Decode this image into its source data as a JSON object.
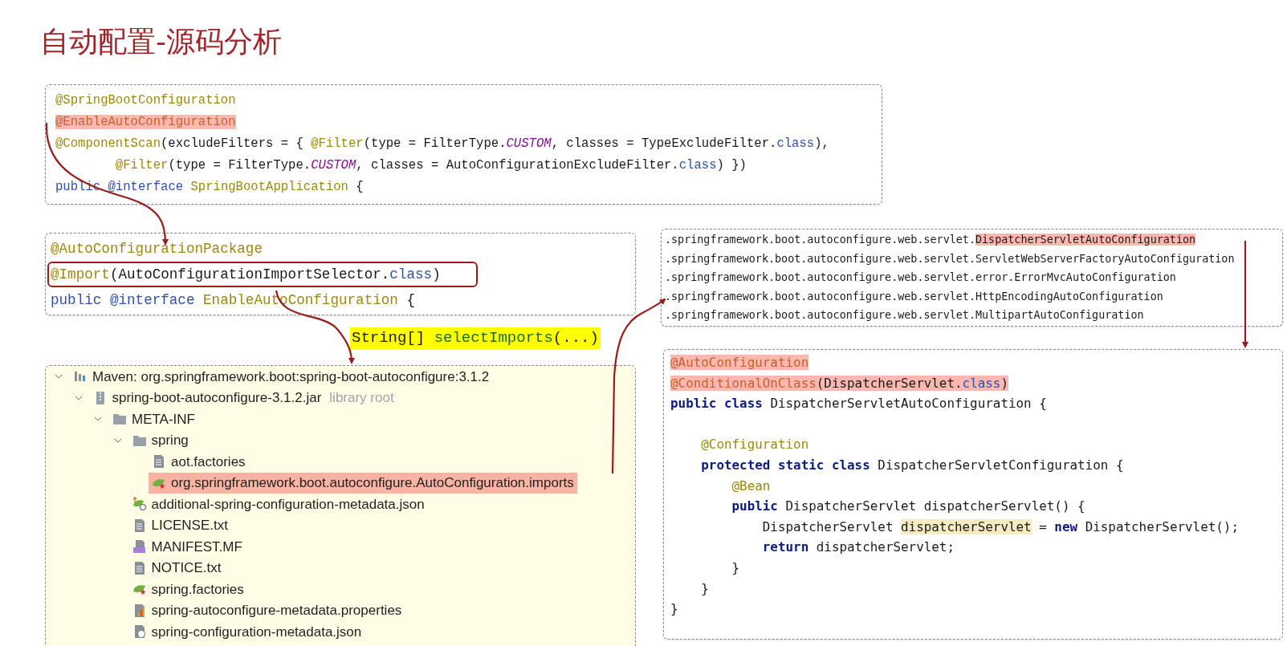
{
  "title": "自动配置-源码分析",
  "top_code": {
    "lines": [
      {
        "tokens": [
          {
            "text": "@SpringBootConfiguration",
            "kind": "annotation"
          }
        ]
      },
      {
        "tokens": [
          {
            "text": "@EnableAutoConfiguration",
            "kind": "annotation-hl"
          }
        ]
      },
      {
        "tokens": [
          {
            "text": "@ComponentScan",
            "kind": "annotation"
          },
          {
            "text": "(excludeFilters = { ",
            "kind": "text"
          },
          {
            "text": "@Filter",
            "kind": "annotation"
          },
          {
            "text": "(type = FilterType.",
            "kind": "text"
          },
          {
            "text": "CUSTOM",
            "kind": "const"
          },
          {
            "text": ", classes = TypeExcludeFilter.",
            "kind": "text"
          },
          {
            "text": "class",
            "kind": "keyword"
          },
          {
            "text": "),",
            "kind": "text"
          }
        ]
      },
      {
        "tokens": [
          {
            "text": "        @Filter",
            "kind": "annotation"
          },
          {
            "text": "(type = FilterType.",
            "kind": "text"
          },
          {
            "text": "CUSTOM",
            "kind": "const"
          },
          {
            "text": ", classes = AutoConfigurationExcludeFilter.",
            "kind": "text"
          },
          {
            "text": "class",
            "kind": "keyword"
          },
          {
            "text": ") })",
            "kind": "text"
          }
        ]
      },
      {
        "tokens": [
          {
            "text": "public ",
            "kind": "keyword"
          },
          {
            "text": "@interface ",
            "kind": "keyword"
          },
          {
            "text": "SpringBootApplication",
            "kind": "annotation"
          },
          {
            "text": " {",
            "kind": "text"
          }
        ]
      }
    ]
  },
  "enable_code": {
    "lines": [
      {
        "boxed": false,
        "tokens": [
          {
            "text": "@AutoConfigurationPackage",
            "kind": "annotation"
          }
        ]
      },
      {
        "boxed": true,
        "tokens": [
          {
            "text": "@Import",
            "kind": "annotation"
          },
          {
            "text": "(AutoConfigurationImportSelector.",
            "kind": "text"
          },
          {
            "text": "class",
            "kind": "keyword"
          },
          {
            "text": ")",
            "kind": "text"
          }
        ]
      },
      {
        "boxed": false,
        "tokens": [
          {
            "text": "public ",
            "kind": "keyword"
          },
          {
            "text": "@interface ",
            "kind": "keyword"
          },
          {
            "text": "EnableAutoConfiguration",
            "kind": "annotation"
          },
          {
            "text": " {",
            "kind": "text"
          }
        ]
      }
    ]
  },
  "callout": {
    "tokens": [
      {
        "text": "String[] ",
        "kind": "text"
      },
      {
        "text": "selectImports",
        "kind": "method"
      },
      {
        "text": "(...)",
        "kind": "text"
      }
    ]
  },
  "tree": [
    {
      "label": "Maven: org.springframework.boot:spring-boot-autoconfigure:3.1.2",
      "kind": "library",
      "selected": false,
      "expanded": true,
      "children": [
        {
          "label": "spring-boot-autoconfigure-3.1.2.jar",
          "note": "library root",
          "kind": "jar",
          "selected": false,
          "expanded": true,
          "children": [
            {
              "label": "META-INF",
              "kind": "folder",
              "selected": false,
              "expanded": true,
              "children": [
                {
                  "label": "spring",
                  "kind": "folder",
                  "selected": false,
                  "expanded": true,
                  "children": [
                    {
                      "label": "aot.factories",
                      "kind": "file",
                      "selected": false
                    },
                    {
                      "label": "org.springframework.boot.autoconfigure.AutoConfiguration.imports",
                      "kind": "spring",
                      "selected": true
                    }
                  ]
                },
                {
                  "label": "additional-spring-configuration-metadata.json",
                  "kind": "spring-json",
                  "selected": false
                },
                {
                  "label": "LICENSE.txt",
                  "kind": "file",
                  "selected": false
                },
                {
                  "label": "MANIFEST.MF",
                  "kind": "manifest",
                  "selected": false
                },
                {
                  "label": "NOTICE.txt",
                  "kind": "file",
                  "selected": false
                },
                {
                  "label": "spring.factories",
                  "kind": "spring",
                  "selected": false
                },
                {
                  "label": "spring-autoconfigure-metadata.properties",
                  "kind": "properties",
                  "selected": false
                },
                {
                  "label": "spring-configuration-metadata.json",
                  "kind": "json",
                  "selected": false
                }
              ]
            }
          ]
        }
      ]
    }
  ],
  "imports_list": {
    "lines": [
      {
        "tokens": [
          {
            "text": ".springframework.boot.autoconfigure.web.servlet.",
            "kind": "text"
          },
          {
            "text": "DispatcherServletAutoConfiguration",
            "kind": "text-hl"
          }
        ]
      },
      {
        "tokens": [
          {
            "text": ".springframework.boot.autoconfigure.web.servlet.ServletWebServerFactoryAutoConfiguration",
            "kind": "text"
          }
        ]
      },
      {
        "tokens": [
          {
            "text": ".springframework.boot.autoconfigure.web.servlet.error.ErrorMvcAutoConfiguration",
            "kind": "text"
          }
        ]
      },
      {
        "tokens": [
          {
            "text": ".springframework.boot.autoconfigure.web.servlet.HttpEncodingAutoConfiguration",
            "kind": "text"
          }
        ]
      },
      {
        "tokens": [
          {
            "text": ".springframework.boot.autoconfigure.web.servlet.MultipartAutoConfiguration",
            "kind": "text"
          }
        ]
      }
    ]
  },
  "class_code": {
    "lines": [
      {
        "tokens": [
          {
            "text": "@AutoConfiguration",
            "kind": "annotation-hl"
          }
        ]
      },
      {
        "tokens": [
          {
            "text": "@ConditionalOnClass",
            "kind": "annotation-hl"
          },
          {
            "text": "(DispatcherServlet.",
            "kind": "text-hl"
          },
          {
            "text": "class",
            "kind": "keyword-hl"
          },
          {
            "text": ")",
            "kind": "text-hl"
          }
        ]
      },
      {
        "tokens": [
          {
            "text": "public class ",
            "kind": "keyword-bold"
          },
          {
            "text": "DispatcherServletAutoConfiguration {",
            "kind": "text"
          }
        ]
      },
      {
        "tokens": [
          {
            "text": "    @Configuration",
            "kind": "annotation"
          }
        ]
      },
      {
        "tokens": [
          {
            "text": "    protected static class ",
            "kind": "keyword-bold"
          },
          {
            "text": "DispatcherServletConfiguration {",
            "kind": "text"
          }
        ]
      },
      {
        "tokens": [
          {
            "text": "        @Bean",
            "kind": "annotation"
          }
        ]
      },
      {
        "tokens": [
          {
            "text": "        public ",
            "kind": "keyword-bold"
          },
          {
            "text": "DispatcherServlet dispatcherServlet() {",
            "kind": "text"
          }
        ]
      },
      {
        "tokens": [
          {
            "text": "            DispatcherServlet ",
            "kind": "text"
          },
          {
            "text": "dispatcherServlet",
            "kind": "var-hl"
          },
          {
            "text": " = ",
            "kind": "text"
          },
          {
            "text": "new ",
            "kind": "keyword-bold"
          },
          {
            "text": "DispatcherServlet();",
            "kind": "text"
          }
        ]
      },
      {
        "tokens": [
          {
            "text": "            return ",
            "kind": "keyword-bold"
          },
          {
            "text": "dispatcherServlet;",
            "kind": "text"
          }
        ]
      },
      {
        "tokens": [
          {
            "text": "        }",
            "kind": "text"
          }
        ]
      },
      {
        "tokens": [
          {
            "text": "    }",
            "kind": "text"
          }
        ]
      },
      {
        "tokens": [
          {
            "text": "}",
            "kind": "text"
          }
        ]
      }
    ]
  }
}
